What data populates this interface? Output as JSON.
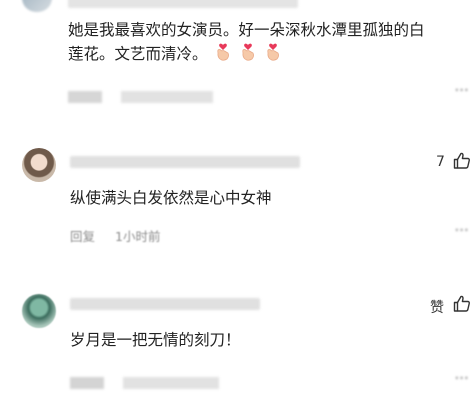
{
  "comments": [
    {
      "text_line1": "她是我最喜欢的女演员。好一朵深秋水潭里孤独的白",
      "text_line2": "莲花。文艺而清冷。",
      "reactions": [
        "finger-heart",
        "finger-heart",
        "finger-heart"
      ]
    },
    {
      "like_count": "7",
      "text": "纵使满头白发依然是心中女神",
      "meta_left": "回复",
      "meta_time": "1小时前"
    },
    {
      "like_label": "赞",
      "text": "岁月是一把无情的刻刀！"
    }
  ],
  "colors": {
    "text": "#222222",
    "meta": "#8c8c8c",
    "icon": "#333333",
    "heart": "#e8395a",
    "hand": "#f6c9a8"
  },
  "icons": [
    "thumbs-up-icon",
    "more-dots-icon",
    "finger-heart-icon"
  ]
}
